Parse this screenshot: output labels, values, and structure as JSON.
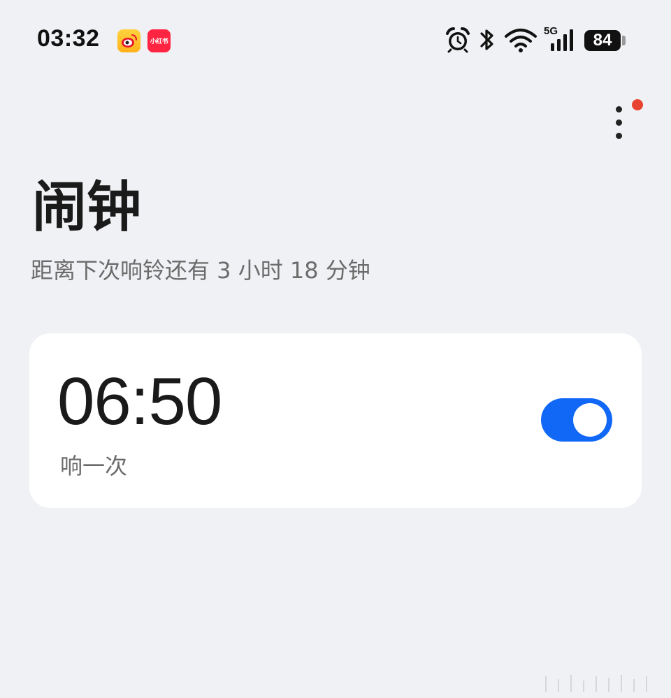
{
  "status_bar": {
    "time": "03:32",
    "apps": [
      {
        "name": "weibo",
        "icon": "weibo-icon"
      },
      {
        "name": "xiaohongshu",
        "icon": "xiaohongshu-icon",
        "label": "小红书"
      }
    ],
    "network": "5G",
    "battery": "84",
    "icons": [
      "alarm-icon",
      "bluetooth-icon",
      "wifi-icon",
      "cellular-signal-icon",
      "battery-icon"
    ]
  },
  "header": {
    "more_icon": "more-vertical-icon",
    "badge_color": "#e8432f",
    "title": "闹钟",
    "subtitle": "距离下次响铃还有 3 小时 18 分钟"
  },
  "alarms": [
    {
      "time": "06:50",
      "repeat": "响一次",
      "enabled": true
    }
  ],
  "colors": {
    "background": "#f0f1f4",
    "card": "#ffffff",
    "accent": "#1168f6",
    "secondary_text": "#6b6b6b"
  }
}
